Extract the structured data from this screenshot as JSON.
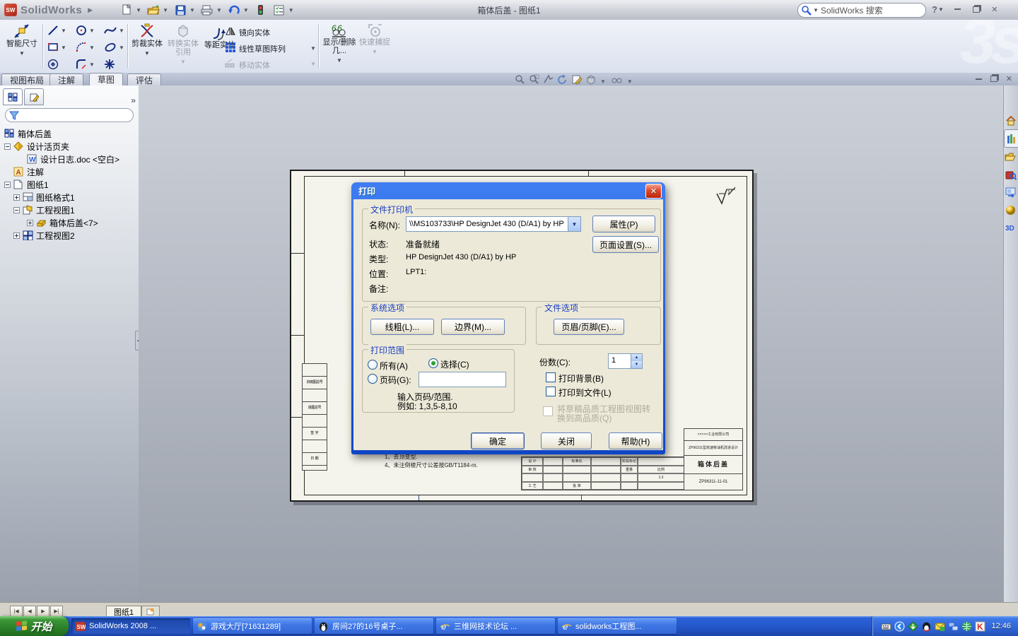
{
  "titlebar": {
    "brand": "SolidWorks",
    "title": "箱体后盖 - 图纸1",
    "search": "SolidWorks 搜索",
    "help": "?"
  },
  "ribbon": {
    "smart_dim": "智能尺寸",
    "trim": "剪裁实体",
    "convert": "转换实体引用",
    "offset": "等距实体",
    "mirror": "镜向实体",
    "pattern": "线性草图阵列",
    "move": "移动实体",
    "display_delete": "显示/删除几...",
    "quick_snap": "快速捕捉"
  },
  "tabs": {
    "t0": "视图布局",
    "t1": "注解",
    "t2": "草图",
    "t3": "评估"
  },
  "panel": {
    "root": "箱体后盖",
    "i0": "设计活页夹",
    "i1": "设计日志.doc <空白>",
    "i2": "注解",
    "i3": "图纸1",
    "i4": "图纸格式1",
    "i5": "工程视图1",
    "i6": "箱体后盖<7>",
    "i7": "工程视图2"
  },
  "dialog": {
    "title": "打印",
    "printer_group": "文件打印机",
    "name_label": "名称(N):",
    "name_value": "\\\\MS103733\\HP DesignJet 430 (D/A1) by HP",
    "properties_btn": "属性(P)",
    "page_setup_btn": "页面设置(S)...",
    "status_label": "状态:",
    "status_value": "准备就绪",
    "type_label": "类型:",
    "type_value": "HP DesignJet 430 (D/A1) by HP",
    "location_label": "位置:",
    "location_value": "LPT1:",
    "comment_label": "备注:",
    "system_group": "系统选项",
    "line_weight_btn": "线粗(L)...",
    "margin_btn": "边界(M)...",
    "doc_group": "文件选项",
    "header_footer_btn": "页眉/页脚(E)...",
    "range_group": "打印范围",
    "radio_all": "所有(A)",
    "radio_pages": "页码(G):",
    "radio_selection": "选择(C)",
    "hint1": "输入页码/范围.",
    "hint2": "例如: 1,3,5-8,10",
    "copies_label": "份数(C):",
    "copies_value": "1",
    "chk_background": "打印背景(B)",
    "chk_tofile": "打印到文件(L)",
    "chk_quality1": "将草稿品质工程图视图转",
    "chk_quality2": "换到高品质(Q)",
    "ok_btn": "确定",
    "close_btn": "关闭",
    "help_btn": "帮助(H)"
  },
  "sheet": {
    "note1": "1、去顶变型.",
    "note2": "4、未注倒棱尺寸公差按GB/T1184-m.",
    "tb_company": "×××××工业有限公司",
    "tb_project": "ZP96311型高速柴油机改进设计",
    "tb_part": "箱体后盖",
    "tb_number": "ZP96311-11-01",
    "tb_design": "设 计",
    "tb_check": "审 核",
    "tb_process": "工 艺",
    "tb_std": "标准化",
    "tb_approve": "批 准",
    "tb_stage": "阶段标记",
    "tb_weight": "重量",
    "tb_scale": "比例",
    "tb_scale_value": "1:3",
    "side1": "旧底图总号",
    "side2": "底图总号",
    "side3": "签 字",
    "side4": "日 期"
  },
  "sheettabs": {
    "tab": "图纸1"
  },
  "taskbar": {
    "start": "开始",
    "b0": "SolidWorks 2008 ...",
    "b1": "游戏大厅[71631289]",
    "b2": "房间27的16号桌子...",
    "b3": "三维网技术论坛 ...",
    "b4": "solidworks工程图...",
    "time": "12:46"
  }
}
